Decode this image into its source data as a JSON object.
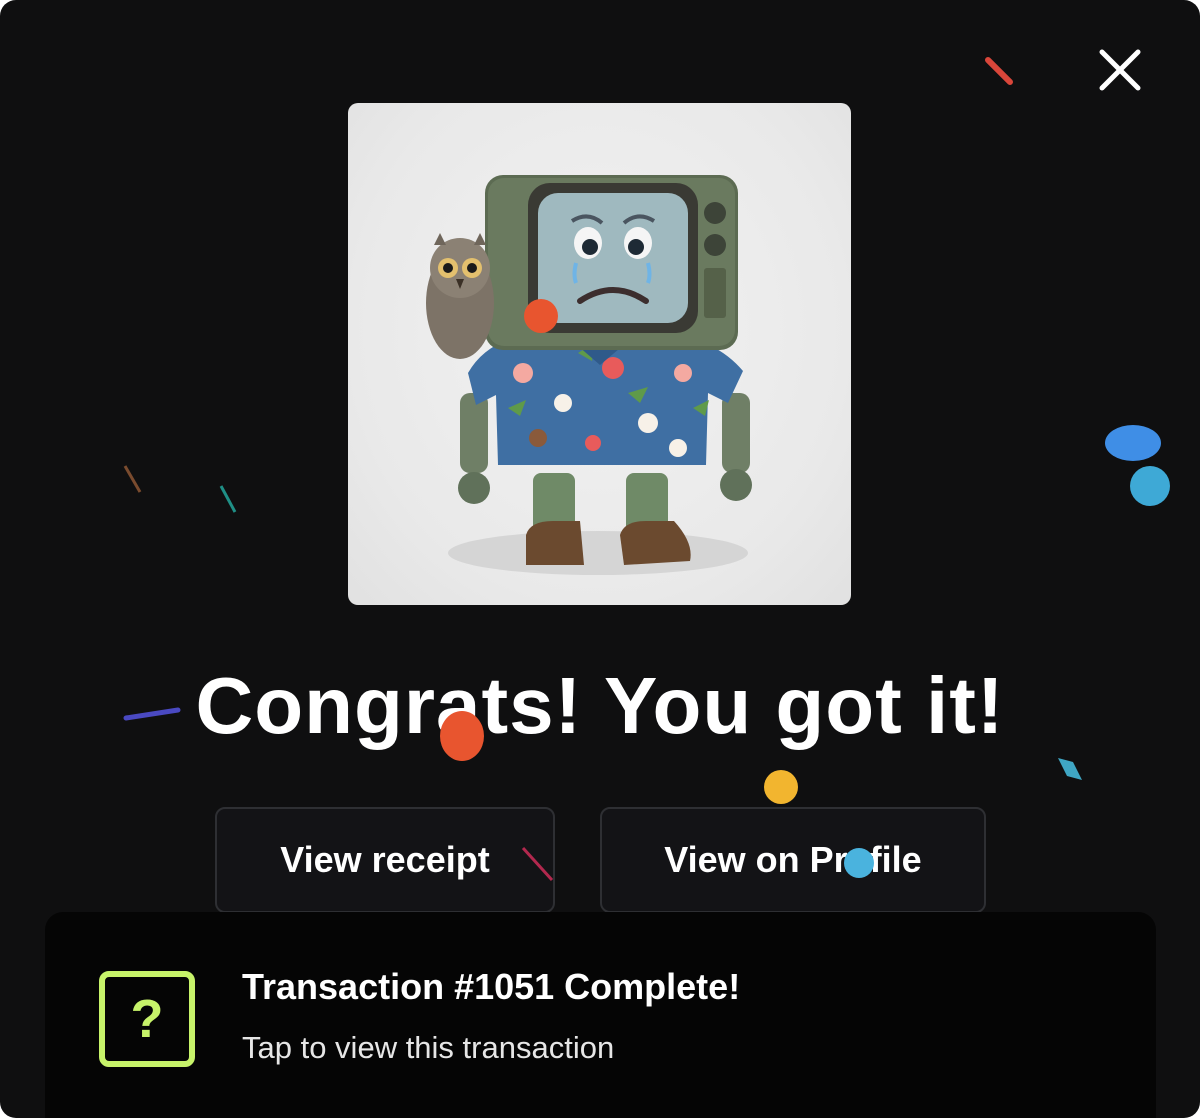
{
  "dialog": {
    "close_icon": "close-icon",
    "artwork": {
      "subject": "nft-artwork",
      "background_color": "#ececec"
    },
    "headline": "Congrats! You got it!",
    "buttons": {
      "view_receipt": "View receipt",
      "view_on_profile": "View on Profile"
    }
  },
  "toast": {
    "icon": "question-icon",
    "icon_glyph": "?",
    "title": "Transaction #1051 Complete!",
    "subtitle": "Tap to view this transaction",
    "accent_color": "#c7f36a"
  },
  "colors": {
    "background": "#0f0f10",
    "button_border": "#2e2f33",
    "text": "#ffffff"
  }
}
